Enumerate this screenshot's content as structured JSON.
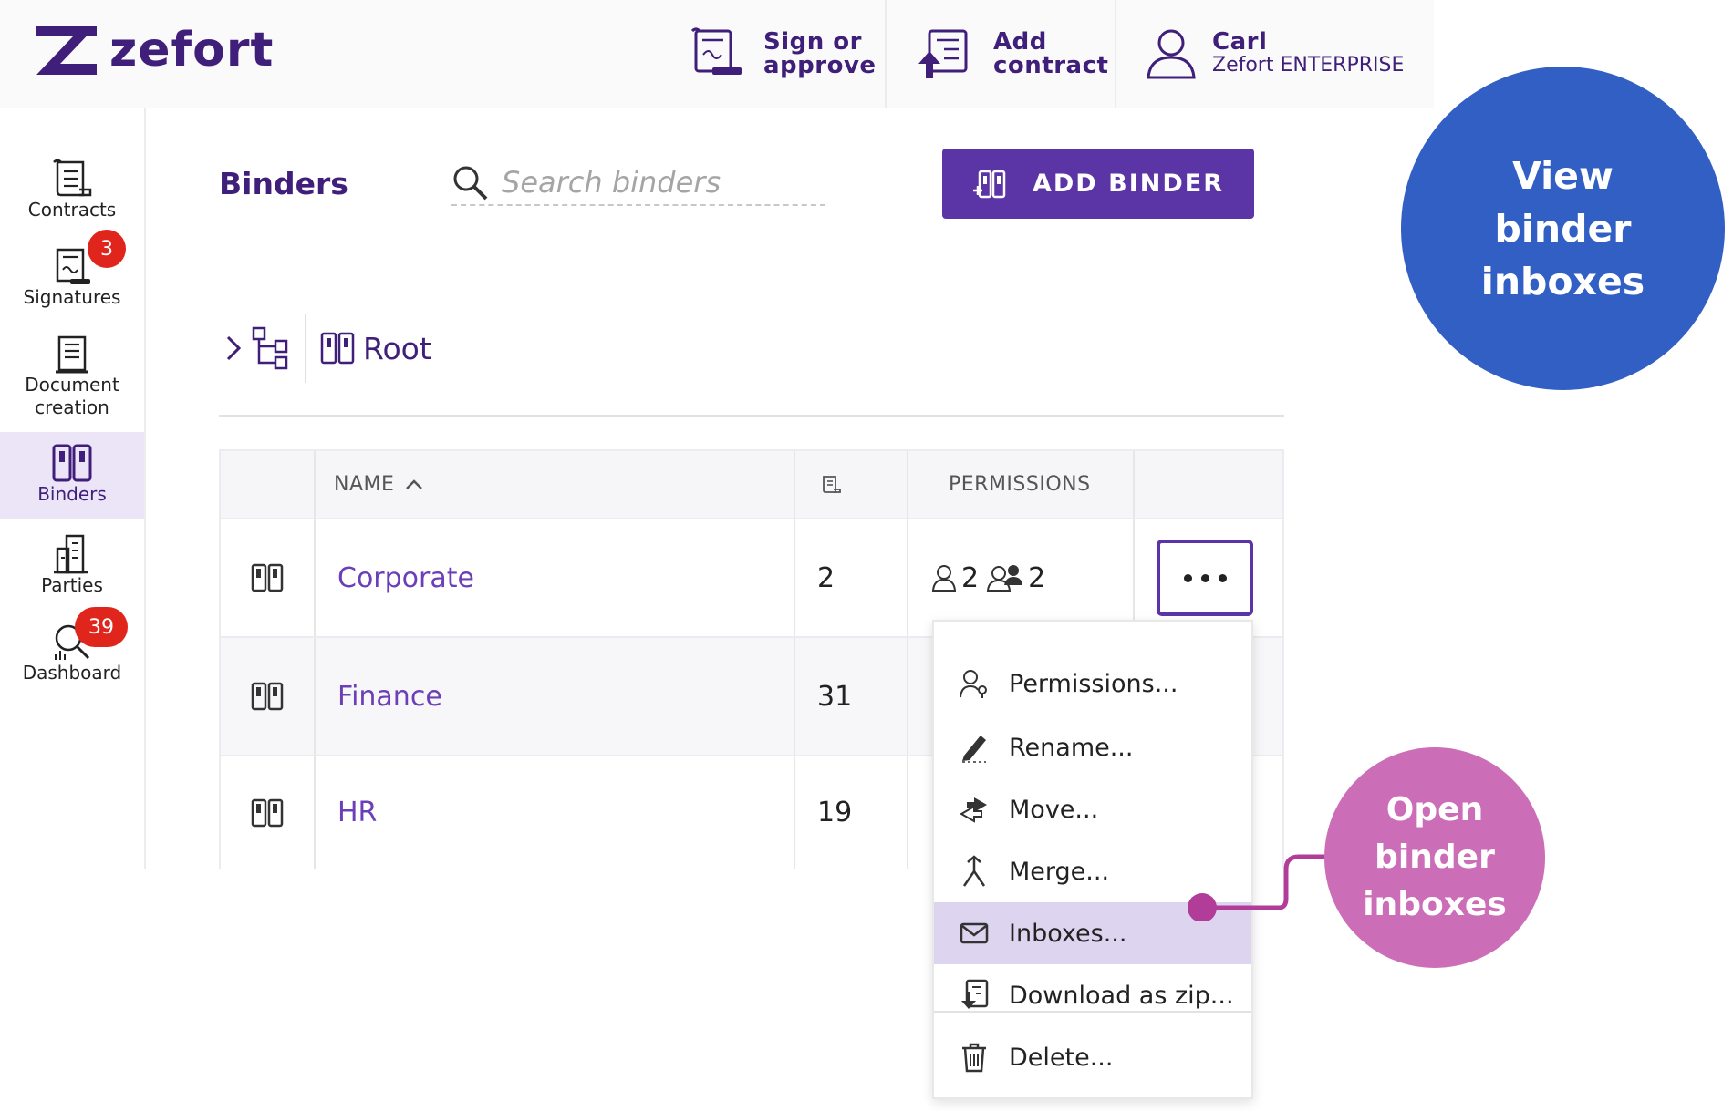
{
  "app": {
    "brand": "zefort",
    "brand_color": "#3f1f7a",
    "accent": "#5b34a6"
  },
  "header": {
    "sign": {
      "line1": "Sign or",
      "line2": "approve",
      "icon": "sign-contract-icon"
    },
    "add": {
      "line1": "Add",
      "line2": "contract",
      "icon": "upload-contract-icon"
    },
    "user": {
      "name": "Carl",
      "org": "Zefort ENTERPRISE",
      "icon": "user-icon"
    }
  },
  "sidebar": {
    "items": [
      {
        "label": "Contracts",
        "icon": "contracts-icon"
      },
      {
        "label": "Signatures",
        "icon": "signatures-icon",
        "badge": "3"
      },
      {
        "label_line1": "Document",
        "label_line2": "creation",
        "icon": "document-icon"
      },
      {
        "label": "Binders",
        "icon": "binders-icon",
        "active": true
      },
      {
        "label": "Parties",
        "icon": "parties-icon"
      },
      {
        "label": "Dashboard",
        "icon": "dashboard-icon",
        "badge": "39"
      }
    ]
  },
  "main": {
    "title": "Binders",
    "search": {
      "placeholder": "Search binders"
    },
    "add_binder": "ADD BINDER",
    "breadcrumb": {
      "root": "Root"
    }
  },
  "table": {
    "headers": {
      "name": "NAME",
      "permissions": "PERMISSIONS"
    },
    "rows": [
      {
        "name": "Corporate",
        "count": "2",
        "users": "2",
        "groups": "2"
      },
      {
        "name": "Finance",
        "count": "31"
      },
      {
        "name": "HR",
        "count": "19"
      }
    ]
  },
  "menu": {
    "items": [
      {
        "label": "Permissions...",
        "icon": "permissions-icon"
      },
      {
        "label": "Rename...",
        "icon": "pencil-icon"
      },
      {
        "label": "Move...",
        "icon": "move-icon"
      },
      {
        "label": "Merge...",
        "icon": "merge-icon"
      },
      {
        "label": "Inboxes...",
        "icon": "envelope-icon",
        "highlighted": true
      },
      {
        "label": "Download as zip...",
        "icon": "download-icon"
      },
      {
        "label": "Delete...",
        "icon": "trash-icon"
      }
    ]
  },
  "callouts": {
    "view": {
      "lines": [
        "View",
        "binder",
        "inboxes"
      ],
      "color": "#325fc4"
    },
    "open": {
      "lines": [
        "Open",
        "binder",
        "inboxes"
      ],
      "color": "#cc6db8"
    }
  }
}
